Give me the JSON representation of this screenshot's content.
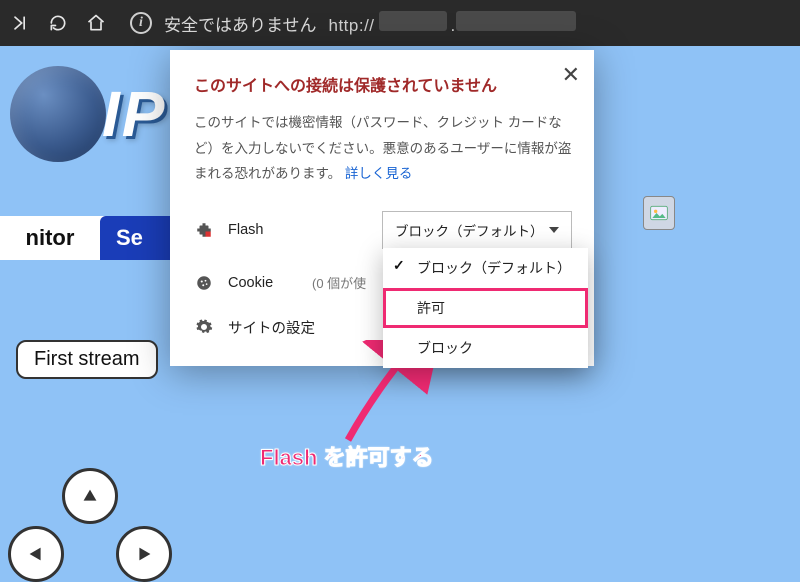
{
  "toolbar": {
    "not_secure_label": "安全ではありません",
    "url_prefix": "http://"
  },
  "page": {
    "logo_text": "IP",
    "tab_monitor_partial": "nitor",
    "tab_second_partial": "Se",
    "first_stream_button": "First stream"
  },
  "popup": {
    "title": "このサイトへの接続は保護されていません",
    "body": "このサイトでは機密情報（パスワード、クレジット カードなど）を入力しないでください。悪意のあるユーザーに情報が盗まれる恐れがあります。",
    "learn_more": "詳しく見る",
    "flash": {
      "label": "Flash",
      "selected": "ブロック（デフォルト）",
      "options": {
        "block_default": "ブロック（デフォルト）",
        "allow": "許可",
        "block": "ブロック"
      }
    },
    "cookie": {
      "label": "Cookie",
      "sub": "(0 個が使"
    },
    "site_settings": "サイトの設定"
  },
  "annotation": {
    "text": "Flash を許可する"
  }
}
